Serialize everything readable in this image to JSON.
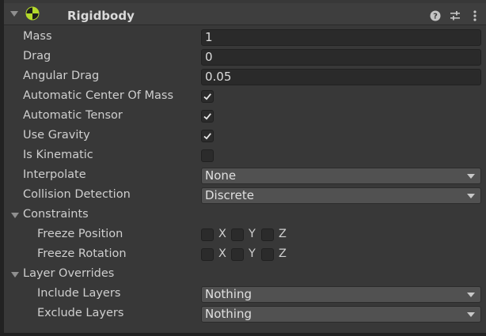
{
  "component": {
    "title": "Rigidbody",
    "icons": [
      "rigidbody-icon",
      "help-icon",
      "presets-icon",
      "more-options-icon"
    ]
  },
  "fields": {
    "mass": {
      "label": "Mass",
      "value": "1"
    },
    "drag": {
      "label": "Drag",
      "value": "0"
    },
    "angular_drag": {
      "label": "Angular Drag",
      "value": "0.05"
    },
    "automatic_center_of_mass": {
      "label": "Automatic Center Of Mass",
      "checked": true
    },
    "automatic_tensor": {
      "label": "Automatic Tensor",
      "checked": true
    },
    "use_gravity": {
      "label": "Use Gravity",
      "checked": true
    },
    "is_kinematic": {
      "label": "Is Kinematic",
      "checked": false
    },
    "interpolate": {
      "label": "Interpolate",
      "value": "None"
    },
    "collision_detection": {
      "label": "Collision Detection",
      "value": "Discrete"
    }
  },
  "constraints": {
    "label": "Constraints",
    "freeze_position": {
      "label": "Freeze Position",
      "x": "X",
      "y": "Y",
      "z": "Z",
      "x_checked": false,
      "y_checked": false,
      "z_checked": false
    },
    "freeze_rotation": {
      "label": "Freeze Rotation",
      "x": "X",
      "y": "Y",
      "z": "Z",
      "x_checked": false,
      "y_checked": false,
      "z_checked": false
    }
  },
  "layer_overrides": {
    "label": "Layer Overrides",
    "include_layers": {
      "label": "Include Layers",
      "value": "Nothing"
    },
    "exclude_layers": {
      "label": "Exclude Layers",
      "value": "Nothing"
    }
  },
  "colors": {
    "background": "#383838",
    "field_bg": "#2a2a2a",
    "dropdown_bg": "#515151",
    "text": "#d2d2d2",
    "icon_green": "#b4d92b"
  }
}
